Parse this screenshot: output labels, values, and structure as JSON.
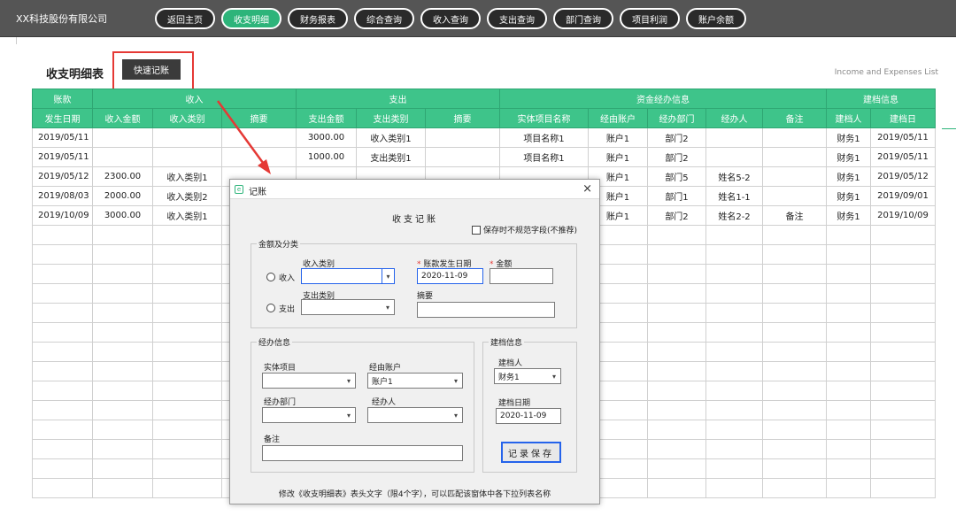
{
  "company": "XX科技股份有限公司",
  "nav": [
    "返回主页",
    "收支明细",
    "财务报表",
    "综合查询",
    "收入查询",
    "支出查询",
    "部门查询",
    "项目利润",
    "账户余额"
  ],
  "page": {
    "title": "收支明细表",
    "quick_button": "快速记账",
    "english_title": "Income and Expenses List"
  },
  "table": {
    "group_headers": [
      "账款",
      "收入",
      "支出",
      "资金经办信息",
      "建档信息"
    ],
    "date_header": "发生日期",
    "sub_headers": [
      "收入金额",
      "收入类别",
      "摘要",
      "支出金额",
      "支出类别",
      "摘要",
      "实体项目名称",
      "经由账户",
      "经办部门",
      "经办人",
      "备注",
      "建档人",
      "建档日"
    ],
    "rows": [
      [
        "2019/05/11",
        "",
        "",
        "",
        "3000.00",
        "收入类别1",
        "",
        "项目名称1",
        "账户1",
        "部门2",
        "",
        "",
        "财务1",
        "2019/05/11"
      ],
      [
        "2019/05/11",
        "",
        "",
        "",
        "1000.00",
        "支出类别1",
        "",
        "项目名称1",
        "账户1",
        "部门2",
        "",
        "",
        "财务1",
        "2019/05/11"
      ],
      [
        "2019/05/12",
        "2300.00",
        "收入类别1",
        "",
        "",
        "",
        "",
        "",
        "账户1",
        "部门5",
        "姓名5-2",
        "",
        "财务1",
        "2019/05/12"
      ],
      [
        "2019/08/03",
        "2000.00",
        "收入类别2",
        "",
        "",
        "",
        "",
        "",
        "账户1",
        "部门1",
        "姓名1-1",
        "",
        "财务1",
        "2019/09/01"
      ],
      [
        "2019/10/09",
        "3000.00",
        "收入类别1",
        "",
        "",
        "",
        "",
        "",
        "账户1",
        "部门2",
        "姓名2-2",
        "备注",
        "财务1",
        "2019/10/09"
      ]
    ]
  },
  "dialog": {
    "title": "记账",
    "close": "×",
    "heading": "收支记账",
    "checkbox_label": "保存时不规范字段(不推荐)",
    "group_amount": "金额及分类",
    "income_radio": "收入",
    "expense_radio": "支出",
    "income_type_label": "收入类别",
    "expense_type_label": "支出类别",
    "date_label": "账款发生日期",
    "date_value": "2020-11-09",
    "amount_label": "金额",
    "summary_label": "摘要",
    "group_handler": "经办信息",
    "project_label": "实体项目",
    "account_label": "经由账户",
    "account_value": "账户1",
    "dept_label": "经办部门",
    "person_label": "经办人",
    "note_label": "备注",
    "group_archive": "建档信息",
    "creator_label": "建档人",
    "creator_value": "财务1",
    "archive_date_label": "建档日期",
    "archive_date_value": "2020-11-09",
    "save_button": "记录保存",
    "footer": "修改《收支明细表》表头文字（限4个字），可以匹配该窗体中各下拉列表名称"
  },
  "colors": {
    "accent": "#3ec48a",
    "topbar": "#555555",
    "highlight": "#e53935",
    "focus": "#2563eb"
  }
}
